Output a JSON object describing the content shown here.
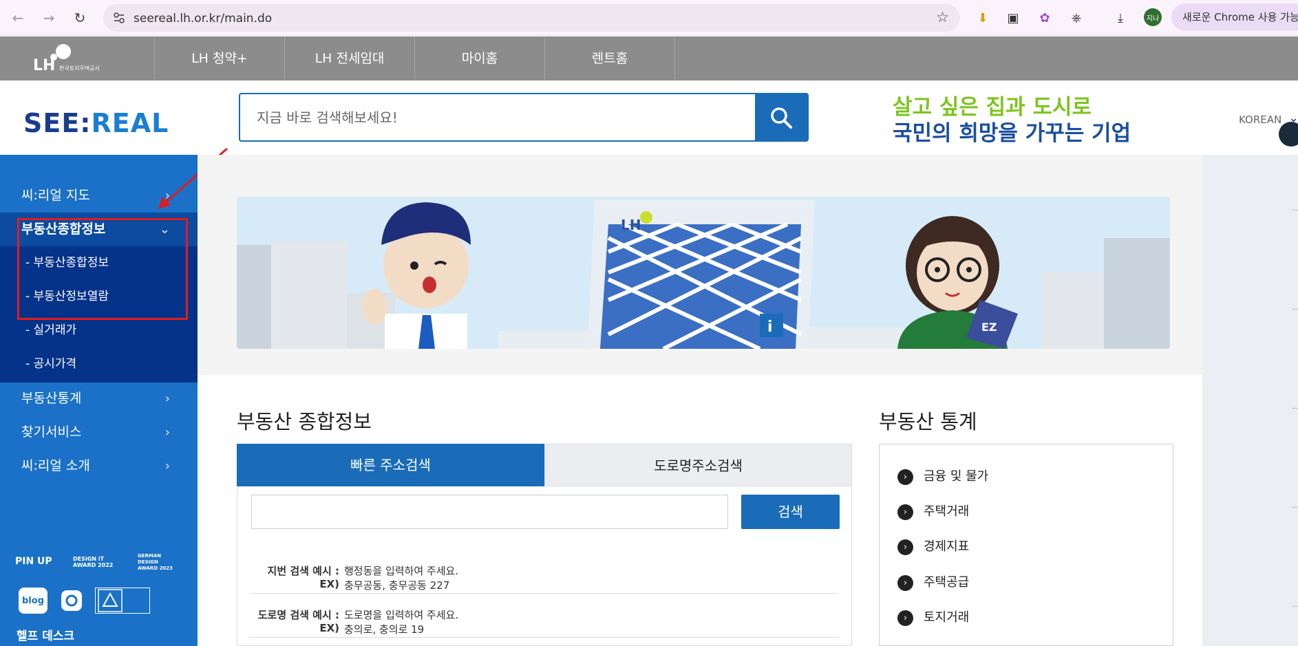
{
  "browser": {
    "url": "seereal.lh.or.kr/main.do",
    "profile_label": "지나",
    "new_chrome_label": "새로운 Chrome 사용 가능"
  },
  "lh_nav": {
    "logo_text": "LH 한국토지주택공사",
    "tabs": [
      "LH 청약+",
      "LH 전세임대",
      "마이홈",
      "렌트홈"
    ]
  },
  "header": {
    "logo_part1": "SEE:",
    "logo_part2": "REAL",
    "search_placeholder": "지금 바로 검색해보세요!",
    "slogan_line1": "살고 싶은 집과 도시로",
    "slogan_line2": "국민의 희망을 가꾸는 기업",
    "language": "KOREAN"
  },
  "sidebar": {
    "items": [
      {
        "label": "씨:리얼 지도"
      },
      {
        "label": "부동산종합정보"
      },
      {
        "label": "부동산통계"
      },
      {
        "label": "찾기서비스"
      },
      {
        "label": "씨:리얼 소개"
      }
    ],
    "sub_items": [
      "- 부동산종합정보",
      "- 부동산정보열람",
      "- 실거래가",
      "- 공시가격"
    ],
    "awards": [
      "PIN UP",
      "DESIGN iT AWARD 2022",
      "GERMAN DESIGN AWARD 2023"
    ],
    "social": [
      "blog",
      "instagram",
      "web-accessibility"
    ],
    "help_desk": "헬프 데스크"
  },
  "main": {
    "section_info_title": "부동산 종합정보",
    "tab_fast": "빠른 주소검색",
    "tab_road": "도로명주소검색",
    "search_button": "검색",
    "hints": [
      {
        "label": "지번 검색 예시 :",
        "value": "행정동을 입력하여 주세요."
      },
      {
        "label": "EX)",
        "value": "충무공동, 충무공동 227"
      },
      {
        "label": "도로명 검색 예시 :",
        "value": "도로명을 입력하여 주세요."
      },
      {
        "label": "EX)",
        "value": "충의로, 충의로 19"
      }
    ],
    "section_stats_title": "부동산 통계",
    "stats_items": [
      "금융 및 물가",
      "주택거래",
      "경제지표",
      "주택공급",
      "토지거래"
    ]
  },
  "colors": {
    "primary_blue": "#1a6cb8",
    "sidebar_blue": "#1a71c7",
    "sidebar_dark": "#06338a",
    "slogan_green": "#7dc41f",
    "highlight_red": "#e21c1c"
  }
}
